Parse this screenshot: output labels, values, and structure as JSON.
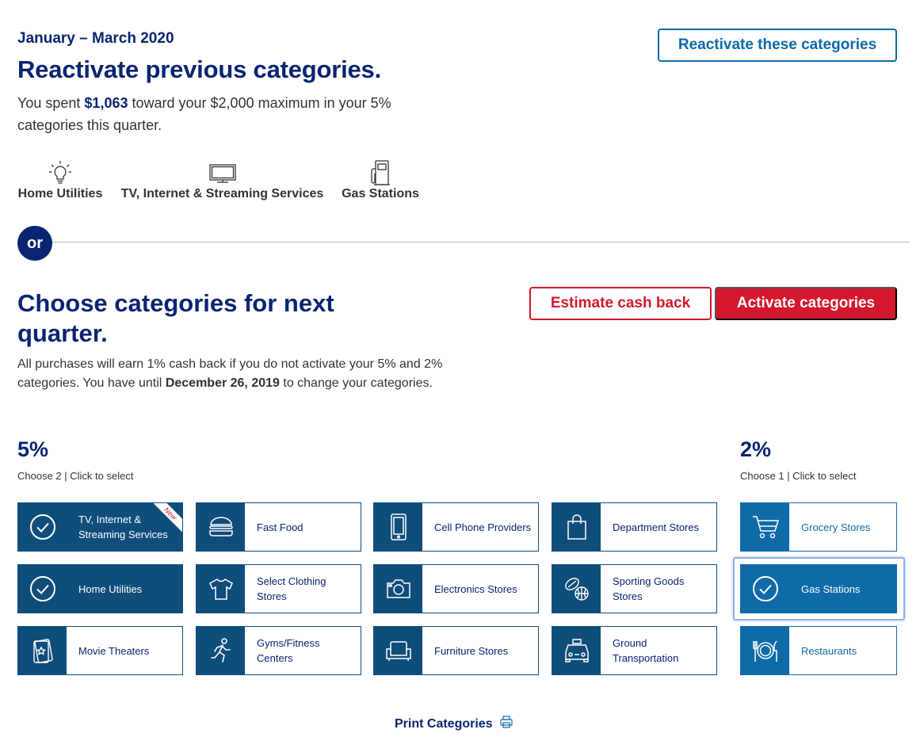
{
  "previous": {
    "quarter": "January – March 2020",
    "title": "Reactivate previous categories.",
    "spent_prefix": "You spent ",
    "spent_amount": "$1,063",
    "spent_suffix": " toward your $2,000 maximum in your 5% categories this quarter.",
    "reactivate_button": "Reactivate these categories",
    "categories": [
      {
        "label": "Home Utilities",
        "icon": "lightbulb-icon"
      },
      {
        "label": "TV, Internet & Streaming Services",
        "icon": "tv-icon"
      },
      {
        "label": "Gas Stations",
        "icon": "gas-pump-icon"
      }
    ]
  },
  "divider": {
    "or_label": "or"
  },
  "next": {
    "title": "Choose categories for next quarter.",
    "desc_prefix": "All purchases will earn 1% cash back if you do not activate your 5% and 2% categories. You have until ",
    "desc_date": "December 26, 2019",
    "desc_suffix": " to change your categories.",
    "estimate_button": "Estimate cash back",
    "activate_button": "Activate categories"
  },
  "five_pct": {
    "heading": "5%",
    "instruction": "Choose 2 | Click to select",
    "new_badge": "New",
    "tiles": [
      {
        "label": "TV, Internet & Streaming Services",
        "icon": "check-icon",
        "selected": true,
        "badge": true
      },
      {
        "label": "Fast Food",
        "icon": "burger-icon",
        "selected": false
      },
      {
        "label": "Cell Phone Providers",
        "icon": "phone-icon",
        "selected": false
      },
      {
        "label": "Department Stores",
        "icon": "shopping-bag-icon",
        "selected": false
      },
      {
        "label": "Home Utilities",
        "icon": "check-icon",
        "selected": true
      },
      {
        "label": "Select Clothing Stores",
        "icon": "shirt-icon",
        "selected": false
      },
      {
        "label": "Electronics Stores",
        "icon": "camera-icon",
        "selected": false
      },
      {
        "label": "Sporting Goods Stores",
        "icon": "sports-balls-icon",
        "selected": false
      },
      {
        "label": "Movie Theaters",
        "icon": "ticket-icon",
        "selected": false
      },
      {
        "label": "Gyms/Fitness Centers",
        "icon": "runner-icon",
        "selected": false
      },
      {
        "label": "Furniture Stores",
        "icon": "armchair-icon",
        "selected": false
      },
      {
        "label": "Ground Transportation",
        "icon": "taxi-icon",
        "selected": false
      }
    ]
  },
  "two_pct": {
    "heading": "2%",
    "instruction": "Choose 1 | Click to select",
    "tiles": [
      {
        "label": "Grocery Stores",
        "icon": "cart-icon",
        "selected": false
      },
      {
        "label": "Gas Stations",
        "icon": "check-icon",
        "selected": true
      },
      {
        "label": "Restaurants",
        "icon": "plate-utensils-icon",
        "selected": false
      }
    ]
  },
  "footer": {
    "print_label": "Print Categories",
    "print_icon": "printer-icon"
  },
  "colors": {
    "navy": "#0a2472",
    "tile_blue": "#0f4d7a",
    "bright_blue": "#0f6aa8",
    "red": "#d3172d"
  }
}
